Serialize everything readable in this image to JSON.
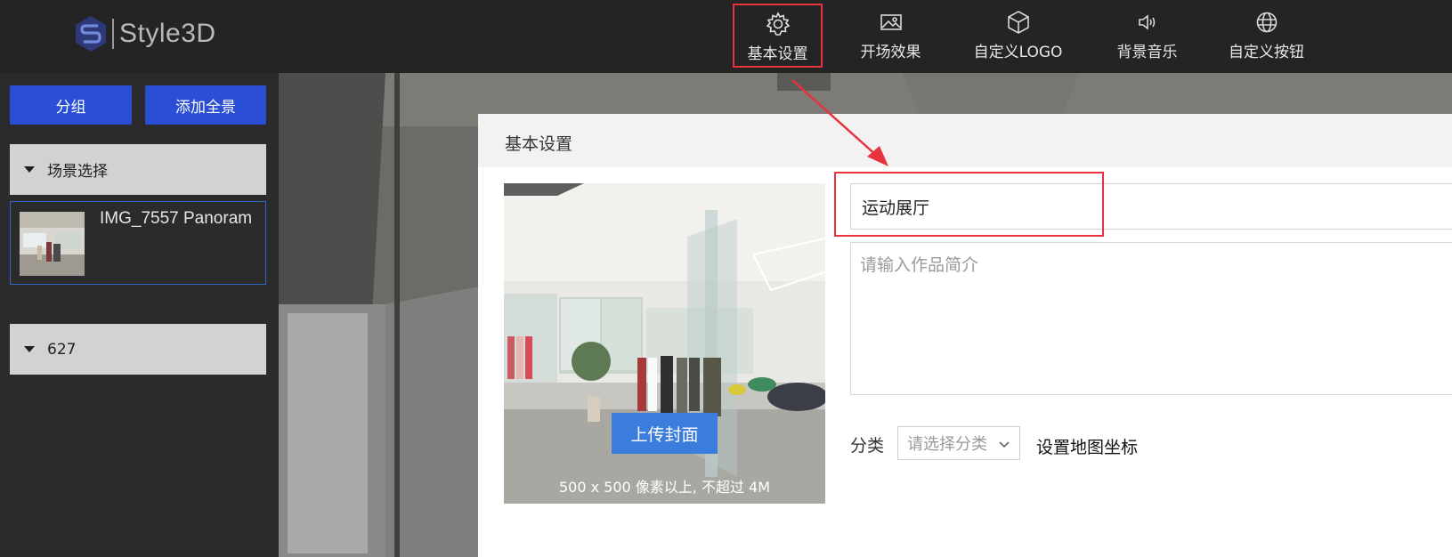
{
  "logo": {
    "text": "Style3D"
  },
  "nav": [
    {
      "label": "基本设置",
      "icon": "gear-icon",
      "active": true
    },
    {
      "label": "开场效果",
      "icon": "image-icon"
    },
    {
      "label": "自定义LOGO",
      "icon": "cube-icon"
    },
    {
      "label": "背景音乐",
      "icon": "speaker-icon"
    },
    {
      "label": "自定义按钮",
      "icon": "globe-icon"
    }
  ],
  "sidebar": {
    "group_button": "分组",
    "add_panorama_button": "添加全景",
    "sections": [
      {
        "label": "场景选择",
        "items": [
          {
            "name": "IMG_7557 Panoram"
          }
        ]
      },
      {
        "label": "627"
      }
    ]
  },
  "modal": {
    "title": "基本设置",
    "upload_label": "上传封面",
    "cover_hint": "500 x 500 像素以上, 不超过 4M",
    "title_value": "运动展厅",
    "description_placeholder": "请输入作品简介",
    "category_label": "分类",
    "category_placeholder": "请选择分类",
    "map_link": "设置地图坐标"
  },
  "colors": {
    "accent_blue": "#2a4ed6",
    "highlight_red": "#e8323c",
    "upload_blue": "#3b7ddd"
  }
}
